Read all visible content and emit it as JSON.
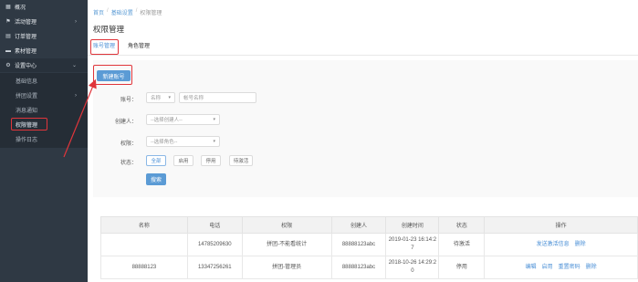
{
  "sidebar": {
    "items": [
      {
        "icon": "grid-icon",
        "label": "概况"
      },
      {
        "icon": "flag-icon",
        "label": "活动管理",
        "chevron": "›"
      },
      {
        "icon": "document-icon",
        "label": "订单管理"
      },
      {
        "icon": "folder-icon",
        "label": "素材管理"
      },
      {
        "icon": "gear-icon",
        "label": "设置中心",
        "chevron": "⌄"
      }
    ],
    "sub_items": [
      {
        "label": "基础信息"
      },
      {
        "label": "拼团设置",
        "chevron": "›"
      },
      {
        "label": "消息通知"
      },
      {
        "label": "权限管理"
      },
      {
        "label": "操作日志"
      }
    ]
  },
  "breadcrumb": {
    "home": "首页",
    "sep": "/",
    "settings": "基础设置",
    "current": "权限管理"
  },
  "page_title": "权限管理",
  "tabs": [
    {
      "label": "账号管理",
      "active": true
    },
    {
      "label": "角色管理",
      "active": false
    }
  ],
  "toolbar": {
    "new_account": "新建账号"
  },
  "filters": {
    "account_label": "账号：",
    "account_type": "名称",
    "account_placeholder": "帐号名称",
    "creator_label": "创建人：",
    "creator_placeholder": "--选择创建人--",
    "role_label": "权限：",
    "role_placeholder": "--选择角色--",
    "status_label": "状态：",
    "status_options": [
      "全部",
      "启用",
      "停用",
      "待激活"
    ],
    "search_button": "搜索"
  },
  "table": {
    "headers": [
      "名称",
      "电话",
      "权限",
      "创建人",
      "创建时间",
      "状态",
      "操作"
    ],
    "rows": [
      {
        "name": "",
        "phone": "14785209630",
        "role": "拼团-不能看统计",
        "creator": "88888123abc",
        "created_line1": "2019-01-23 16:14:2",
        "created_line2": "7",
        "status": "待激活",
        "actions": [
          "发送激活信息",
          "删除"
        ]
      },
      {
        "name": "88888123",
        "phone": "13347256261",
        "role": "拼团-管理员",
        "creator": "88888123abc",
        "created_line1": "2018-10-26 14:29:2",
        "created_line2": "0",
        "status": "停用",
        "actions": [
          "编辑",
          "启用",
          "重置密码",
          "删除"
        ]
      }
    ]
  },
  "colors": {
    "sidebar_bg": "#2f3944",
    "accent": "#4a8fd6",
    "primary_btn": "#5b9bd5",
    "highlight": "#e0353b"
  }
}
